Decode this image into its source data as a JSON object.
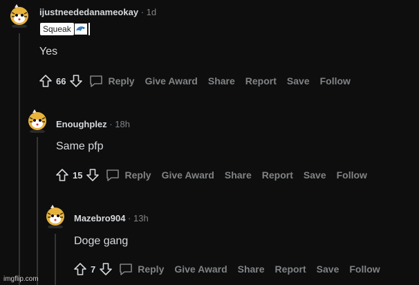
{
  "colors": {
    "background": "#0e0e0f",
    "text": "#d7dadc",
    "muted": "#818384",
    "thread_line": "#343536"
  },
  "comments": [
    {
      "username": "ijustneededanameokay",
      "separator": "·",
      "time": "1d",
      "flair": {
        "text": "Squeak",
        "emoji": "dolphin-emoji"
      },
      "body": "Yes",
      "votes": "66",
      "actions": {
        "reply": "Reply",
        "give_award": "Give Award",
        "share": "Share",
        "report": "Report",
        "save": "Save",
        "follow": "Follow"
      }
    },
    {
      "username": "Enoughplez",
      "separator": "·",
      "time": "18h",
      "body": "Same pfp",
      "votes": "15",
      "actions": {
        "reply": "Reply",
        "give_award": "Give Award",
        "share": "Share",
        "report": "Report",
        "save": "Save",
        "follow": "Follow"
      }
    },
    {
      "username": "Mazebro904",
      "separator": "·",
      "time": "13h",
      "body": "Doge gang",
      "votes": "7",
      "actions": {
        "reply": "Reply",
        "give_award": "Give Award",
        "share": "Share",
        "report": "Report",
        "save": "Save",
        "follow": "Follow"
      }
    }
  ],
  "watermark": "imgflip.com"
}
